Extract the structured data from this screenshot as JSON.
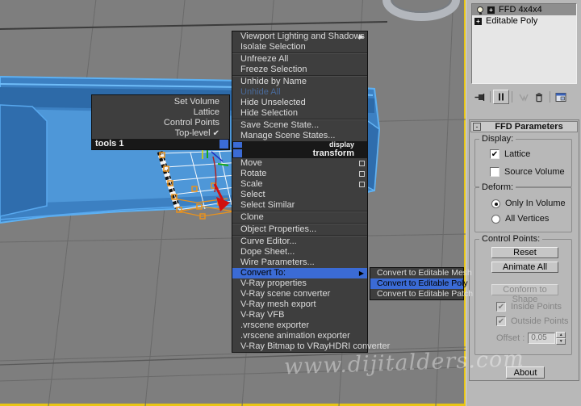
{
  "icons": {
    "submenu_arrow": "▶",
    "check": "✔",
    "plus": "+",
    "minus": "-",
    "spinner_up": "▲",
    "spinner_down": "▼"
  },
  "colors": {
    "highlight_blue": "#3b6bd5",
    "viewport_border": "#e8c515",
    "menu_bg": "#3e3e3e",
    "panel_bg": "#b8b8b8",
    "sofa_blue": "#3c80c2"
  },
  "viewport": {
    "watermark": "www.dijitalders.com"
  },
  "quad_menu": {
    "tools_title": "tools 1",
    "display_title": "display",
    "transform_title": "transform",
    "tools_items": [
      {
        "label": "Set Volume"
      },
      {
        "label": "Lattice"
      },
      {
        "label": "Control Points"
      },
      {
        "label": "Top-level",
        "checked": true
      }
    ],
    "display_items": [
      {
        "label": "Viewport Lighting and Shadows"
      },
      {
        "label": "Isolate Selection"
      },
      {
        "label": "Unfreeze All"
      },
      {
        "label": "Freeze Selection"
      },
      {
        "label": "Unhide by Name"
      },
      {
        "label": "Unhide All",
        "disabled": true
      },
      {
        "label": "Hide Unselected"
      },
      {
        "label": "Hide Selection"
      },
      {
        "label": "Save Scene State..."
      },
      {
        "label": "Manage Scene States..."
      }
    ],
    "transform_items": [
      {
        "label": "Move"
      },
      {
        "label": "Rotate"
      },
      {
        "label": "Scale"
      },
      {
        "label": "Select"
      },
      {
        "label": "Select Similar"
      },
      {
        "label": "Clone"
      },
      {
        "label": "Object Properties..."
      },
      {
        "label": "Curve Editor..."
      },
      {
        "label": "Dope Sheet..."
      },
      {
        "label": "Wire Parameters..."
      },
      {
        "label": "Convert To:",
        "highlighted": true
      },
      {
        "label": "V-Ray properties"
      },
      {
        "label": "V-Ray scene converter"
      },
      {
        "label": "V-Ray mesh export"
      },
      {
        "label": "V-Ray VFB"
      },
      {
        "label": ".vrscene exporter"
      },
      {
        "label": ".vrscene animation exporter"
      },
      {
        "label": "V-Ray Bitmap to VRayHDRI converter"
      }
    ],
    "convert_submenu": [
      {
        "label": "Convert to Editable Mesh"
      },
      {
        "label": "Convert to Editable Poly",
        "highlighted": true
      },
      {
        "label": "Convert to Editable Patch"
      }
    ]
  },
  "command_panel": {
    "modifier_stack": {
      "rows": [
        {
          "label": "FFD 4x4x4",
          "selected": true
        },
        {
          "label": "Editable Poly"
        }
      ]
    },
    "rollout_title": "FFD Parameters",
    "display_group": {
      "title": "Display:",
      "lattice": "Lattice",
      "source_volume": "Source Volume"
    },
    "deform_group": {
      "title": "Deform:",
      "only_in_volume": "Only In Volume",
      "all_vertices": "All Vertices"
    },
    "control_points_group": {
      "title": "Control Points:",
      "reset": "Reset",
      "animate_all": "Animate All",
      "conform_to_shape": "Conform to Shape",
      "inside_points": "Inside Points",
      "outside_points": "Outside Points",
      "offset_label": "Offset :",
      "offset_value": "0,05"
    },
    "about_button": "About"
  }
}
